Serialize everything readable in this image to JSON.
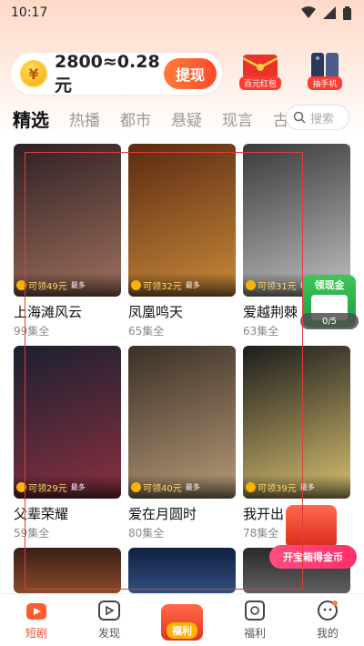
{
  "status": {
    "time": "10:17"
  },
  "wallet": {
    "coin_symbol": "¥",
    "balance_text": "2800≈0.28元",
    "withdraw_label": "提现"
  },
  "promos": [
    {
      "label": "百元红包",
      "icon": "red-envelope-icon"
    },
    {
      "label": "抽手机",
      "icon": "phone-prize-icon"
    }
  ],
  "tabs": [
    "精选",
    "热播",
    "都市",
    "悬疑",
    "现言",
    "古"
  ],
  "search": {
    "placeholder": "搜索"
  },
  "cards": [
    {
      "title": "上海滩风云",
      "episodes": "99集全",
      "reward": "可领49元",
      "more": "最多",
      "art": [
        "#2d2024",
        "#a0705c"
      ]
    },
    {
      "title": "凤凰鸣天",
      "episodes": "65集全",
      "reward": "可领32元",
      "more": "最多",
      "art": [
        "#5a2a12",
        "#c98a3a"
      ]
    },
    {
      "title": "爱越荆棘",
      "episodes": "63集全",
      "reward": "可领31元",
      "more": "最多",
      "art": [
        "#3a3a3a",
        "#c0c0c0"
      ]
    },
    {
      "title": "父辈荣耀",
      "episodes": "59集全",
      "reward": "可领29元",
      "more": "最多",
      "art": [
        "#1a2030",
        "#8a3040"
      ]
    },
    {
      "title": "爱在月圆时",
      "episodes": "80集全",
      "reward": "可领40元",
      "more": "最多",
      "art": [
        "#3a3026",
        "#b89a78"
      ]
    },
    {
      "title": "我开出",
      "episodes": "78集全",
      "reward": "可领39元",
      "more": "最多",
      "art": [
        "#1c1c1c",
        "#d8c070"
      ]
    }
  ],
  "float_widget": {
    "label": "领现金",
    "count": "0/5"
  },
  "treasure": {
    "label": "开宝箱得金币"
  },
  "nav": [
    {
      "label": "短剧",
      "icon": "short-drama-icon",
      "active": true
    },
    {
      "label": "发现",
      "icon": "play-icon",
      "active": false
    },
    {
      "label": "福利",
      "icon": "gift-icon",
      "active": false,
      "center": true
    },
    {
      "label": "福利",
      "icon": "grid-icon",
      "active": false
    },
    {
      "label": "我的",
      "icon": "profile-icon",
      "active": false
    }
  ],
  "colors": {
    "accent": "#ff4b2b",
    "coin": "#f5b400",
    "frame": "#e23b3b"
  }
}
